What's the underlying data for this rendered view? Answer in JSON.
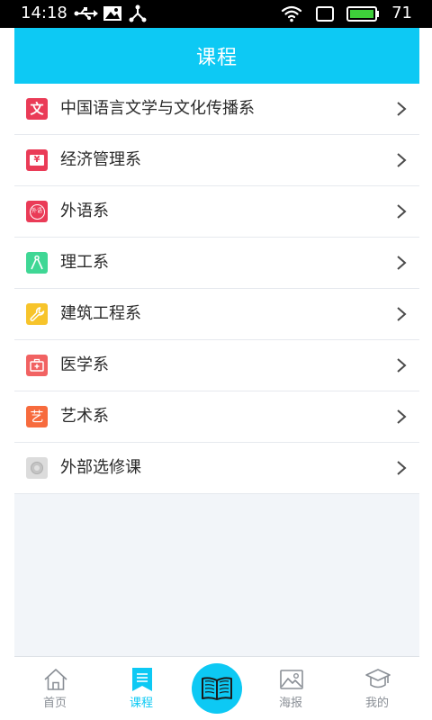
{
  "status_bar": {
    "time": "14:18",
    "battery": "71",
    "icons": [
      "usb-icon",
      "image-icon",
      "share-icon",
      "wifi-icon",
      "screen-rotation-icon",
      "battery-icon"
    ]
  },
  "header": {
    "title": "课程"
  },
  "departments": [
    {
      "label": "中国语言文学与文化传播系",
      "icon": "chinese-literature-icon",
      "icon_glyph": "文",
      "color": "#ea3b57"
    },
    {
      "label": "经济管理系",
      "icon": "economics-icon",
      "icon_glyph": "¥",
      "color": "#ea3b57"
    },
    {
      "label": "外语系",
      "icon": "foreign-language-icon",
      "icon_glyph": "外语",
      "color": "#ea3b57"
    },
    {
      "label": "理工系",
      "icon": "engineering-compass-icon",
      "color": "#3fd795"
    },
    {
      "label": "建筑工程系",
      "icon": "wrench-icon",
      "color": "#f7c42b"
    },
    {
      "label": "医学系",
      "icon": "medical-kit-icon",
      "color": "#f16262"
    },
    {
      "label": "艺术系",
      "icon": "art-icon",
      "icon_glyph": "艺",
      "color": "#f76b3d"
    },
    {
      "label": "外部选修课",
      "icon": "elective-icon",
      "color": "#d8d8d8"
    }
  ],
  "bottom_nav": [
    {
      "label": "首页",
      "icon": "home-icon",
      "active": false
    },
    {
      "label": "课程",
      "icon": "bookmark-list-icon",
      "active": true
    },
    {
      "label": "",
      "icon": "open-book-icon",
      "active": false
    },
    {
      "label": "海报",
      "icon": "picture-icon",
      "active": false
    },
    {
      "label": "我的",
      "icon": "graduation-cap-icon",
      "active": false
    }
  ],
  "colors": {
    "accent": "#0dc9f4",
    "background": "#f2f5f9",
    "text": "#2a2a2a",
    "nav_inactive": "#8a8f96"
  }
}
